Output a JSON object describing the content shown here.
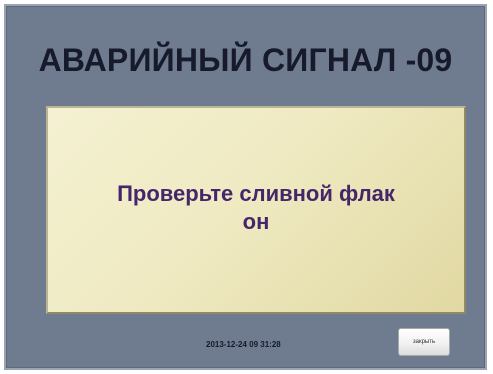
{
  "alarm": {
    "title": "АВАРИЙНЫЙ СИГНАЛ -09",
    "message_line1": "Проверьте сливной флак",
    "message_line2": "он",
    "timestamp": "2013-12-24  09 31:28",
    "close_label": "закрыть"
  },
  "colors": {
    "background": "#6f7c90",
    "panel": "#efeac2",
    "message_text": "#46266a",
    "title_text": "#161a2a"
  }
}
